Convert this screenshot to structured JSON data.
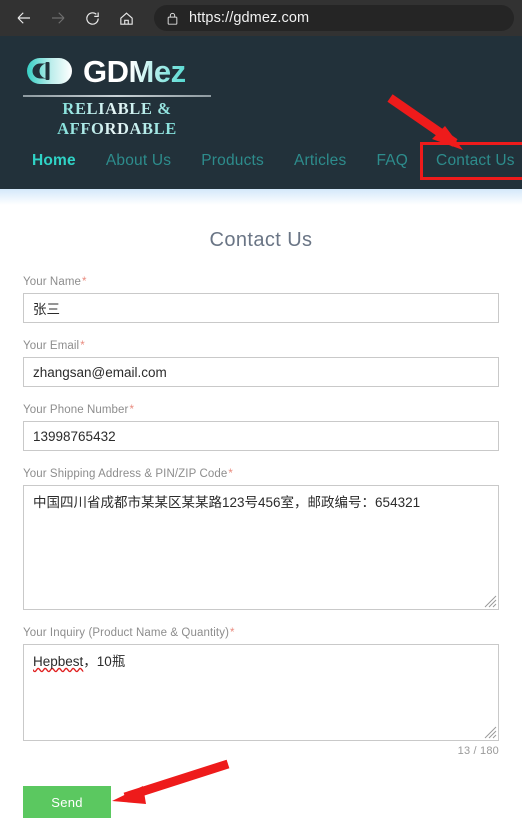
{
  "browser": {
    "back_icon": "arrow-left-icon",
    "forward_icon": "arrow-right-icon",
    "reload_icon": "reload-icon",
    "home_icon": "home-icon",
    "lock_icon": "lock-icon",
    "url": "https://gdmez.com"
  },
  "site": {
    "logo": {
      "mark": "capsule-pill-icon",
      "wordmark": "GDMez",
      "tagline": "RELIABLE & AFFORDABLE"
    },
    "nav": [
      {
        "label": "Home",
        "active": true,
        "highlighted": false
      },
      {
        "label": "About Us",
        "active": false,
        "highlighted": false
      },
      {
        "label": "Products",
        "active": false,
        "highlighted": false
      },
      {
        "label": "Articles",
        "active": false,
        "highlighted": false
      },
      {
        "label": "FAQ",
        "active": false,
        "highlighted": false
      },
      {
        "label": "Contact Us",
        "active": false,
        "highlighted": true
      }
    ]
  },
  "form": {
    "title": "Contact Us",
    "required_mark": "*",
    "fields": {
      "name": {
        "label": "Your Name",
        "value": "张三"
      },
      "email": {
        "label": "Your Email",
        "value": "zhangsan@email.com"
      },
      "phone": {
        "label": "Your Phone Number",
        "value": "13998765432"
      },
      "address": {
        "label": "Your Shipping Address & PIN/ZIP Code",
        "value": "中国四川省成都市某某区某某路123号456室，邮政编号：654321"
      },
      "inquiry": {
        "label": "Your Inquiry (Product Name & Quantity)",
        "value_misspelled": "Hepbest",
        "value_rest": "，10瓶",
        "counter": "13 / 180"
      }
    },
    "submit_label": "Send"
  },
  "annotations": {
    "arrow_color": "#ee1b1b",
    "box_color": "#ee1b1b",
    "arrow_to_contact_us": "red-arrow-icon",
    "arrow_to_send": "red-arrow-icon"
  },
  "colors": {
    "header_bg": "#22313a",
    "nav_active": "#2fd3c6",
    "nav_link": "#2d8c8c",
    "submit_bg": "#5bc860",
    "title": "#6a7585"
  }
}
